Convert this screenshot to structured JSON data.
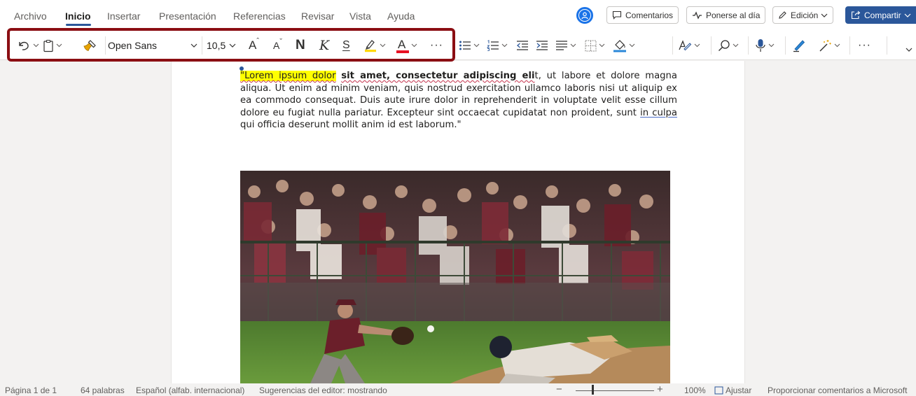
{
  "tabs": [
    {
      "label": "Archivo",
      "active": false
    },
    {
      "label": "Inicio",
      "active": true
    },
    {
      "label": "Insertar",
      "active": false
    },
    {
      "label": "Presentación",
      "active": false
    },
    {
      "label": "Referencias",
      "active": false
    },
    {
      "label": "Revisar",
      "active": false
    },
    {
      "label": "Vista",
      "active": false
    },
    {
      "label": "Ayuda",
      "active": false
    }
  ],
  "header": {
    "comments_label": "Comentarios",
    "catchup_label": "Ponerse al día",
    "editing_label": "Edición",
    "share_label": "Compartir"
  },
  "ribbon": {
    "font_name": "Open Sans",
    "font_size": "10,5",
    "bold_glyph": "N",
    "italic_glyph": "K",
    "strike_glyph": "S",
    "font_color_glyph": "A",
    "grow_glyph": "A",
    "shrink_glyph": "A",
    "highlight_color": "#ffd800",
    "font_color": "#e81123"
  },
  "document": {
    "paragraph": {
      "s1": "\"Lorem ipsum dolor",
      "s2": " ",
      "s3": "sit amet, consectetur adipiscing eli",
      "s4": "t",
      "s5": ",  ut labore et dolore magna aliqua. Ut enim ad minim veniam, quis nostrud exercitation ullamco laboris nisi ut aliquip ex ea commodo consequat. Duis aute irure dolor in reprehenderit in voluptate velit esse cillum dolore eu fugiat nulla pariatur. Excepteur sint occaecat cupidatat non proident, sunt ",
      "s6": "in culpa",
      "s7": " qui officia deserunt mollit anim id est laborum.\""
    }
  },
  "status": {
    "page": "Página 1 de 1",
    "words": "64 palabras",
    "language": "Español (alfab. internacional)",
    "suggestions": "Sugerencias del editor: mostrando",
    "zoom_minus": "−",
    "zoom_plus": "+",
    "zoom_value": "100%",
    "fit_label": "Ajustar",
    "feedback": "Proporcionar comentarios a Microsoft"
  },
  "colors": {
    "accent": "#2b579a",
    "annotation_box": "#8b0e13",
    "text_highlight": "#ffff00"
  }
}
